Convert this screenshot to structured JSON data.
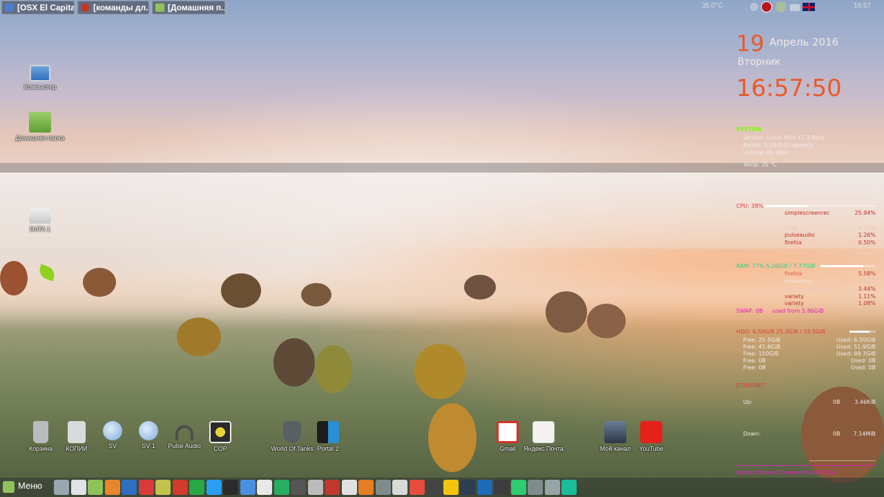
{
  "top_panel": {
    "tabs": [
      {
        "label": "[OSX El Capita...",
        "color": "#4a7fd0"
      },
      {
        "label": "[команды дл...",
        "color": "#c0392b"
      },
      {
        "label": "[Домашняя п...",
        "color": "#8fc25a"
      }
    ],
    "temperature": "35.0°C",
    "clock": "16:57",
    "tray_icons": [
      "network-icon",
      "shield-icon",
      "mail-icon",
      "uk-flag-icon"
    ]
  },
  "desktop_icons": [
    {
      "label": "Компьютер",
      "icon": "computer-icon"
    },
    {
      "label": "Домашняя папка",
      "icon": "home-folder-icon"
    },
    {
      "label": "DATA 1",
      "icon": "drive-icon"
    }
  ],
  "conky": {
    "day": "19",
    "month_year": "Апрель 2016",
    "weekday": "Вторник",
    "time": "16:57:50",
    "system": {
      "title": "SYSTEM",
      "lines": [
        "Version: Linux Mint 17.3 Rosa",
        "Kernel: 3.19.0-32-generic",
        "Uptime: 0h 48m",
        "Temp: 35 °C"
      ]
    },
    "cpu": {
      "title": "CPU: 38%",
      "percent": 38,
      "processes": [
        {
          "name": "simplescreenrec",
          "value": "25.94%"
        },
        {
          "name": "Xorg",
          "value": "4.03%"
        },
        {
          "name": "pulseaudio",
          "value": "1.26%"
        },
        {
          "name": "firefox",
          "value": "0.50%"
        }
      ]
    },
    "ram": {
      "title": "RAM: 77% 5.26GiB / 7.77GiB",
      "percent": 77,
      "processes": [
        {
          "name": "firefox",
          "value": "5.58%"
        },
        {
          "name": "cinnamon",
          "value": "4.63%"
        },
        {
          "name": "simplescreenrec",
          "value": "3.44%"
        },
        {
          "name": "variety",
          "value": "1.11%"
        },
        {
          "name": "variety",
          "value": "1.08%"
        }
      ]
    },
    "swap": {
      "title": "SWAP: 0B",
      "used": "used from 5.86GiB"
    },
    "hdd": {
      "title": "HDD: 6.50GiB 25.3GiB / 33.5GiB",
      "percent": 75,
      "rows": [
        {
          "free": "Free: 25.5GiB",
          "used": "Used: 6.50GiB"
        },
        {
          "free": "Free: 41.6GiB",
          "used": "Used: 51.9GiB"
        },
        {
          "free": "Free: 150GiB",
          "used": "Used: 99.7GiB"
        },
        {
          "free": "Free: 0B",
          "used": "Used: 0B"
        },
        {
          "free": "Free: 0B",
          "used": "Used: 0B"
        }
      ]
    },
    "ethernet": {
      "title": "ETHERNET",
      "up_label": "Up:",
      "up_value": "0B",
      "up_rate": "3.46KiB",
      "down_label": "Down:",
      "down_value": "0B",
      "down_rate": "7.14MiB"
    },
    "footer": "Автор сборки Стамина Фар(OLEG)"
  },
  "dock": [
    {
      "label": "Корзина",
      "icon": "trash-icon",
      "color": "#b9bcbf"
    },
    {
      "label": "КОПИИ",
      "icon": "lock-drive-icon",
      "color": "#d9dadb"
    },
    {
      "label": "SV",
      "icon": "globe-icon",
      "color": "#7ea9d8"
    },
    {
      "label": "SV 1",
      "icon": "globe-icon",
      "color": "#7ea9d8"
    },
    {
      "label": "Pulse Audio",
      "icon": "headphones-icon",
      "color": "#4d4d4d"
    },
    {
      "label": "COP",
      "icon": "radiation-icon",
      "color": "#2b2b2b"
    },
    {
      "label": "World Of Tanks",
      "icon": "tanks-icon",
      "color": "#5a5f63"
    },
    {
      "label": "Portal 2",
      "icon": "portal-icon",
      "color": "#1c1c1c"
    },
    {
      "label": "Gmail",
      "icon": "gmail-icon",
      "color": "#ffffff"
    },
    {
      "label": "Яндекс.Почта",
      "icon": "yandex-mail-icon",
      "color": "#f2f2f2"
    },
    {
      "label": "Мой канал",
      "icon": "avatar-icon",
      "color": "#3d4a5c"
    },
    {
      "label": "YouTube",
      "icon": "youtube-icon",
      "color": "#e62117"
    }
  ],
  "bottom_panel": {
    "menu_label": "Меню",
    "launchers": [
      "#9aa7b0",
      "#dfe3e6",
      "#8fc25a",
      "#e8862e",
      "#2f6fbf",
      "#d93b3b",
      "#c0c44a",
      "#d23a2a",
      "#28a745",
      "#2a9df4",
      "#2b2b2b",
      "#4a90e2",
      "#e8e8e8",
      "#27ae60",
      "#555555",
      "#bbbbbb",
      "#c0392b",
      "#e0e0e0",
      "#e67e22",
      "#7f8c8d",
      "#d9d9d9",
      "#e74c3c",
      "#444444",
      "#f1c40f",
      "#2c3e50",
      "#1e6bb8",
      "#3d3d3d",
      "#2ecc71",
      "#7f8c8d",
      "#95a5a6",
      "#1abc9c"
    ]
  }
}
